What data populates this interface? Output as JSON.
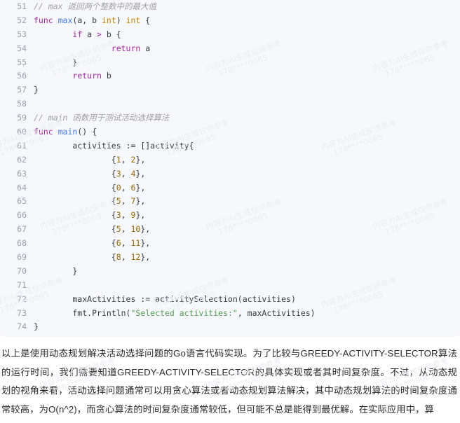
{
  "watermark": {
    "line1": "内容为AI生成仅供参考",
    "line2": "178****0065",
    "color": "#e9ecf2"
  },
  "theme": {
    "code_background": "#f7f8fc",
    "page_background": "#ffffff",
    "gutter_color": "#9aa0ac",
    "comment_color": "#a0a1a7",
    "keyword_color": "#a626a4",
    "function_color": "#4078f2",
    "type_color": "#c18401",
    "number_color": "#986801",
    "string_color": "#50a14f",
    "plain_color": "#383a42",
    "prose_color": "#2b2b2b"
  },
  "code_block": {
    "language": "go",
    "first_line_number": 51,
    "lines": [
      {
        "n": "51",
        "tokens": [
          {
            "t": "// max ",
            "c": "cmt"
          },
          {
            "t": "返回两个整数中的最大值",
            "c": "cmt"
          }
        ]
      },
      {
        "n": "52",
        "tokens": [
          {
            "t": "func ",
            "c": "kw"
          },
          {
            "t": "max",
            "c": "fn"
          },
          {
            "t": "(a, b ",
            "c": "pln"
          },
          {
            "t": "int",
            "c": "typ"
          },
          {
            "t": ") ",
            "c": "pln"
          },
          {
            "t": "int",
            "c": "typ"
          },
          {
            "t": " {",
            "c": "pln"
          }
        ]
      },
      {
        "n": "53",
        "tokens": [
          {
            "t": "        ",
            "c": "pln"
          },
          {
            "t": "if",
            "c": "kw"
          },
          {
            "t": " a ",
            "c": "pln"
          },
          {
            "t": ">",
            "c": "op"
          },
          {
            "t": " b {",
            "c": "pln"
          }
        ]
      },
      {
        "n": "54",
        "tokens": [
          {
            "t": "                ",
            "c": "pln"
          },
          {
            "t": "return",
            "c": "kw"
          },
          {
            "t": " a",
            "c": "pln"
          }
        ]
      },
      {
        "n": "55",
        "tokens": [
          {
            "t": "        }",
            "c": "pln"
          }
        ]
      },
      {
        "n": "56",
        "tokens": [
          {
            "t": "        ",
            "c": "pln"
          },
          {
            "t": "return",
            "c": "kw"
          },
          {
            "t": " b",
            "c": "pln"
          }
        ]
      },
      {
        "n": "57",
        "tokens": [
          {
            "t": "}",
            "c": "pln"
          }
        ]
      },
      {
        "n": "58",
        "tokens": []
      },
      {
        "n": "59",
        "tokens": [
          {
            "t": "// main ",
            "c": "cmt"
          },
          {
            "t": "函数用于测试活动选择算法",
            "c": "cmt"
          }
        ]
      },
      {
        "n": "60",
        "tokens": [
          {
            "t": "func ",
            "c": "kw"
          },
          {
            "t": "main",
            "c": "fn"
          },
          {
            "t": "() {",
            "c": "pln"
          }
        ]
      },
      {
        "n": "61",
        "tokens": [
          {
            "t": "        activities := []activity{",
            "c": "pln"
          }
        ]
      },
      {
        "n": "62",
        "tokens": [
          {
            "t": "                {",
            "c": "pln"
          },
          {
            "t": "1",
            "c": "num"
          },
          {
            "t": ", ",
            "c": "pln"
          },
          {
            "t": "2",
            "c": "num"
          },
          {
            "t": "},",
            "c": "pln"
          }
        ]
      },
      {
        "n": "63",
        "tokens": [
          {
            "t": "                {",
            "c": "pln"
          },
          {
            "t": "3",
            "c": "num"
          },
          {
            "t": ", ",
            "c": "pln"
          },
          {
            "t": "4",
            "c": "num"
          },
          {
            "t": "},",
            "c": "pln"
          }
        ]
      },
      {
        "n": "64",
        "tokens": [
          {
            "t": "                {",
            "c": "pln"
          },
          {
            "t": "0",
            "c": "num"
          },
          {
            "t": ", ",
            "c": "pln"
          },
          {
            "t": "6",
            "c": "num"
          },
          {
            "t": "},",
            "c": "pln"
          }
        ]
      },
      {
        "n": "65",
        "tokens": [
          {
            "t": "                {",
            "c": "pln"
          },
          {
            "t": "5",
            "c": "num"
          },
          {
            "t": ", ",
            "c": "pln"
          },
          {
            "t": "7",
            "c": "num"
          },
          {
            "t": "},",
            "c": "pln"
          }
        ]
      },
      {
        "n": "66",
        "tokens": [
          {
            "t": "                {",
            "c": "pln"
          },
          {
            "t": "3",
            "c": "num"
          },
          {
            "t": ", ",
            "c": "pln"
          },
          {
            "t": "9",
            "c": "num"
          },
          {
            "t": "},",
            "c": "pln"
          }
        ]
      },
      {
        "n": "67",
        "tokens": [
          {
            "t": "                {",
            "c": "pln"
          },
          {
            "t": "5",
            "c": "num"
          },
          {
            "t": ", ",
            "c": "pln"
          },
          {
            "t": "10",
            "c": "num"
          },
          {
            "t": "},",
            "c": "pln"
          }
        ]
      },
      {
        "n": "68",
        "tokens": [
          {
            "t": "                {",
            "c": "pln"
          },
          {
            "t": "6",
            "c": "num"
          },
          {
            "t": ", ",
            "c": "pln"
          },
          {
            "t": "11",
            "c": "num"
          },
          {
            "t": "},",
            "c": "pln"
          }
        ]
      },
      {
        "n": "69",
        "tokens": [
          {
            "t": "                {",
            "c": "pln"
          },
          {
            "t": "8",
            "c": "num"
          },
          {
            "t": ", ",
            "c": "pln"
          },
          {
            "t": "12",
            "c": "num"
          },
          {
            "t": "},",
            "c": "pln"
          }
        ]
      },
      {
        "n": "70",
        "tokens": [
          {
            "t": "        }",
            "c": "pln"
          }
        ]
      },
      {
        "n": "71",
        "tokens": []
      },
      {
        "n": "72",
        "tokens": [
          {
            "t": "        maxActivities := activitySelection(activities)",
            "c": "pln"
          }
        ]
      },
      {
        "n": "73",
        "tokens": [
          {
            "t": "        fmt.Println(",
            "c": "pkg"
          },
          {
            "t": "\"Selected activities:\"",
            "c": "str"
          },
          {
            "t": ", maxActivities)",
            "c": "pln"
          }
        ]
      },
      {
        "n": "74",
        "tokens": [
          {
            "t": "}",
            "c": "pln"
          }
        ]
      }
    ]
  },
  "prose": {
    "paragraph": "以上是使用动态规划解决活动选择问题的Go语言代码实现。为了比较与GREEDY-ACTIVITY-SELECTOR算法的运行时间，我们需要知道GREEDY-ACTIVITY-SELECTOR的具体实现或者其时间复杂度。不过，从动态规划的视角来看，活动选择问题通常可以用贪心算法或者动态规划算法解决，其中动态规划算法的时间复杂度通常较高，为O(n^2)，而贪心算法的时间复杂度通常较低，但可能不总是能得到最优解。在实际应用中，算"
  }
}
